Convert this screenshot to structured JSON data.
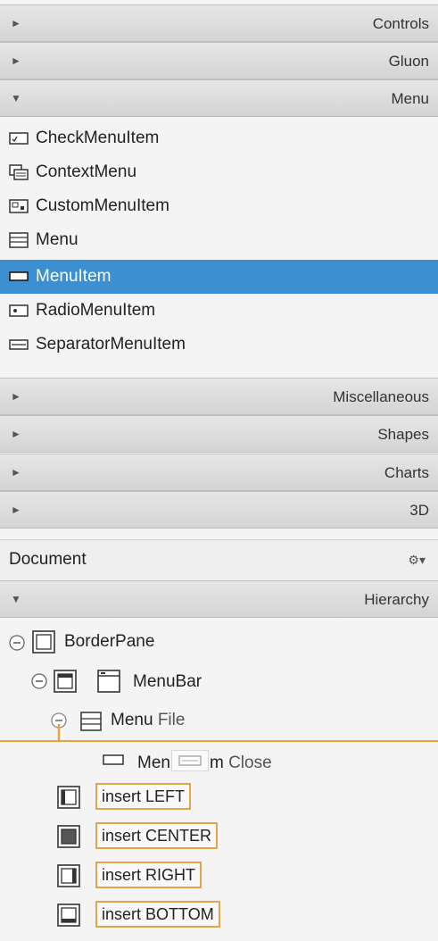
{
  "library": {
    "sections": [
      {
        "title": "Controls",
        "expanded": false
      },
      {
        "title": "Gluon",
        "expanded": false
      },
      {
        "title": "Menu",
        "expanded": true
      },
      {
        "title": "Miscellaneous",
        "expanded": false
      },
      {
        "title": "Shapes",
        "expanded": false
      },
      {
        "title": "Charts",
        "expanded": false
      },
      {
        "title": "3D",
        "expanded": false
      }
    ],
    "menu_items": [
      {
        "label": "CheckMenuItem",
        "icon": "check-menu-item-icon"
      },
      {
        "label": "ContextMenu",
        "icon": "context-menu-icon"
      },
      {
        "label": "CustomMenuItem",
        "icon": "custom-menu-item-icon"
      },
      {
        "label": "Menu",
        "icon": "menu-icon"
      },
      {
        "label": "MenuItem",
        "icon": "menu-item-icon",
        "selected": true
      },
      {
        "label": "RadioMenuItem",
        "icon": "radio-menu-item-icon"
      },
      {
        "label": "SeparatorMenuItem",
        "icon": "separator-menu-item-icon"
      }
    ]
  },
  "document": {
    "title": "Document",
    "gear": "⚙▾",
    "hierarchy_title": "Hierarchy"
  },
  "hierarchy": {
    "border_pane": "BorderPane",
    "menu_bar": "MenuBar",
    "menu_type": "Menu",
    "menu_text": "File",
    "item_type_part1": "Men",
    "item_type_part2": "m",
    "item_text": "Close",
    "insert_left": "insert LEFT",
    "insert_center": "insert CENTER",
    "insert_right": "insert RIGHT",
    "insert_bottom": "insert BOTTOM"
  },
  "colors": {
    "selection": "#3c8fd0",
    "drop_indicator": "#e8a33c"
  }
}
